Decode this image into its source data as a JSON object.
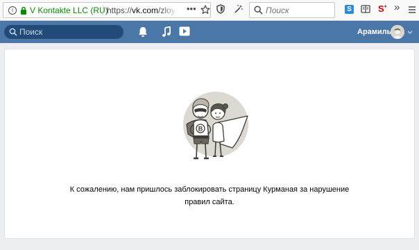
{
  "browser": {
    "org_name": "V Kontakte LLC (RU)",
    "url_prefix": "https://",
    "url_host": "vk.com",
    "url_path": "/zloy",
    "page_actions": "•••",
    "search_placeholder": "Поиск",
    "ext_s_label": "S",
    "ext_s2_label": "S",
    "ext_s2_sup": "+",
    "overflow": "»",
    "info": "i"
  },
  "vk": {
    "search_placeholder": "Поиск",
    "user_name": "Арамиль",
    "brand_color": "#4a76a8"
  },
  "message": {
    "line1": "К сожалению, нам пришлось заблокировать страницу Курманая за нарушение",
    "line2": "правил сайта."
  },
  "illustration": {
    "badge_letter": "В"
  }
}
